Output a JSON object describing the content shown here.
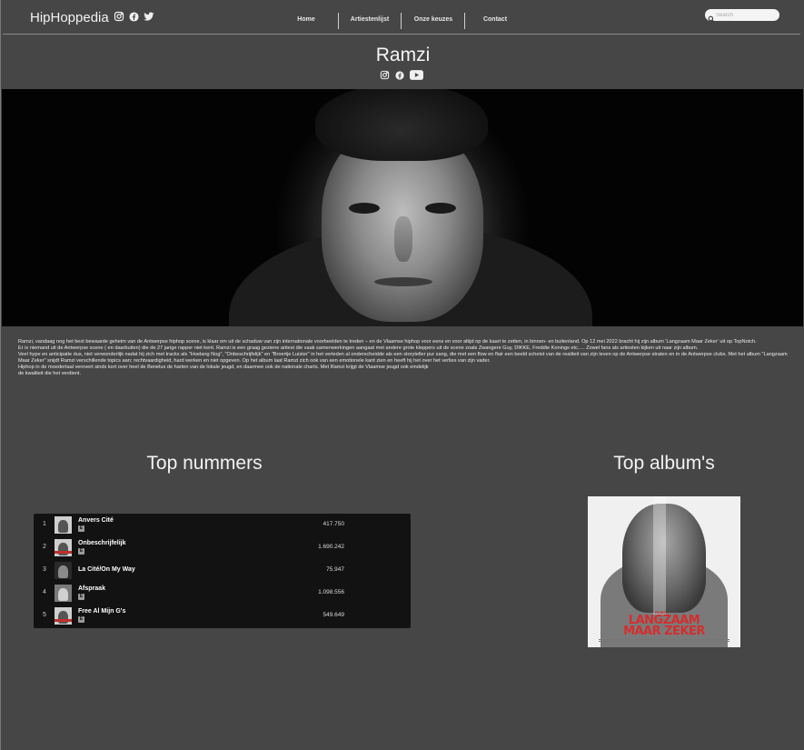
{
  "header": {
    "brand": "HipHoppedia",
    "brand_icons": [
      "instagram-icon",
      "facebook-icon",
      "twitter-icon"
    ],
    "nav": [
      {
        "label": "Home"
      },
      {
        "label": "Artiestenlijst"
      },
      {
        "label": "Onze keuzes"
      },
      {
        "label": "Contact"
      }
    ],
    "search_placeholder": "Search"
  },
  "artist": {
    "name": "Ramzi",
    "social_icons": [
      "instagram-icon",
      "facebook-icon",
      "youtube-icon"
    ]
  },
  "bio": {
    "paragraphs": [
      "Ramzi, vandaag nog het best bewaarde geheim van de Antwerpse hiphop scene, is klaar om uit de schaduw van zijn internationale voorbeelden te treden – en de Vlaamse hiphop voor eens en voor altijd op de kaart te zetten, in binnen- en buitenland. Op 12 mei 2022 bracht hij zijn album 'Langzaam Maar Zeker' uit op TopNotch.",
      "Er is niemand uit de Antwerpse scene ( en daarbuiten) die de 27 jarige rapper niet kent.  Ramzi is een graag geziene artiest die vaak samenwerkingen aangaat met andere grote kleppers uit de scene zoals Zwangere Guy, DIKKE, Freddie Konings etc..... Zowel fans als artiesten kijken uit naar zijn album.",
      "Veel hype en anticipatie dus, niet verwonderlijk nadat hij zich met tracks als \"Hoelang Nog\", \"Onbeschrijfelijk\" en \"Broertje Luister\" in het verleden al onderscheidde als een storyteller pur sang,  die met een flow en flair een beeld schetst van de realiteit van zijn leven op de Antwerpse straten en in de Antwerpse clubs. Met het album \"Langzaam Maar Zeker\" snijdt Ramzi verschillende topics aan; rechtvaardigheid, hard werken en niet opgeven. Op het album laat Ramzi zich ook van een emotionele kant zien en heeft hij het over het verlies van zijn vader.",
      "Hiphop in de moedertaal verovert sinds kort over heel de Benelux de harten van de lokale jeugd, en daarmee ook de nationale charts. Met Ramzi krijgt de Vlaamse jeugd ook eindelijk",
      "de kwaliteit die het verdient."
    ]
  },
  "top_tracks": {
    "title": "Top nummers",
    "tracks": [
      {
        "rank": "1",
        "title": "Anvers Cité",
        "explicit": true,
        "badge": "E",
        "plays": "417.750"
      },
      {
        "rank": "2",
        "title": "Onbeschrijfelijk",
        "explicit": true,
        "badge": "E",
        "plays": "1.690.242"
      },
      {
        "rank": "3",
        "title": "La Cité/On My Way",
        "explicit": false,
        "badge": "",
        "plays": "75.947"
      },
      {
        "rank": "4",
        "title": "Afspraak",
        "explicit": true,
        "badge": "E",
        "plays": "1.098.556"
      },
      {
        "rank": "5",
        "title": "Free Al Mijn G's",
        "explicit": true,
        "badge": "E",
        "plays": "549.649"
      }
    ]
  },
  "top_albums": {
    "title": "Top album's",
    "cover": {
      "artist": "RAMZI",
      "line1": "LANGZAAM",
      "line2": "MAAR ZEKER"
    }
  }
}
